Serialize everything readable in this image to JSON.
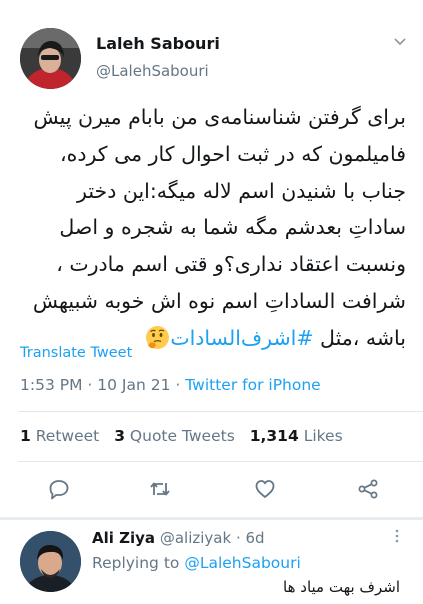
{
  "tweet": {
    "author_name": "Laleh Sabouri",
    "author_handle": "@LalehSabouri",
    "body_plain": "برای گرفتن شناسنامه‌ی من بابام میرن پیش فامیلمون که در ثبت احوال کار می کرده، جناب با شنیدن اسم لاله میگه:این دختر ساداتِ بعدشم مگه شما به شجره و اصل ونسبت اعتقاد نداری؟و قتی اسم مادرت ، شرافت الساداتِ اسم نوه اش خوبه شبیهش باشه ،مثل ",
    "hashtag": "#اشرف‌السادات",
    "emoji_icon": "thinking-face-emoji",
    "translate_label": "Translate Tweet",
    "time": "1:53 PM",
    "date": "10 Jan 21",
    "source": "Twitter for iPhone",
    "stats": {
      "retweets_count": "1",
      "retweets_label": "Retweet",
      "quotes_count": "3",
      "quotes_label": "Quote Tweets",
      "likes_count": "1,314",
      "likes_label": "Likes"
    },
    "actions": [
      "reply-icon",
      "retweet-icon",
      "like-icon",
      "share-icon"
    ]
  },
  "reply": {
    "author_name": "Ali Ziya",
    "author_handle": "@aliziyak",
    "age": "6d",
    "replying_label": "Replying to",
    "replying_to": "@LalehSabouri",
    "text": "اشرف بهت میاد ها"
  },
  "colors": {
    "link": "#1da1f2",
    "secondary": "#657786",
    "primary": "#14171a",
    "divider": "#e1e8ed"
  }
}
